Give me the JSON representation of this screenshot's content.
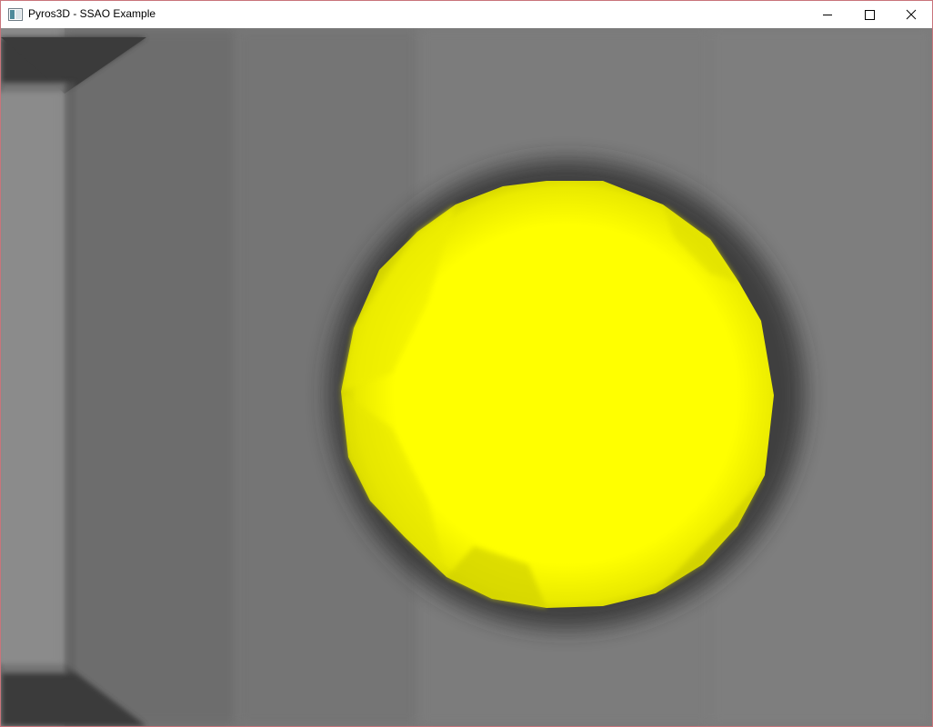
{
  "window": {
    "title": "Pyros3D - SSAO Example",
    "icon": "app-window-icon"
  },
  "caption_buttons": {
    "minimize_icon": "minimize-icon",
    "maximize_icon": "maximize-icon",
    "close_icon": "close-icon"
  },
  "scene": {
    "description_colors": {
      "sphere": "#ffff00",
      "background": "#808080",
      "wall_dark": "#3a3a3a"
    }
  }
}
